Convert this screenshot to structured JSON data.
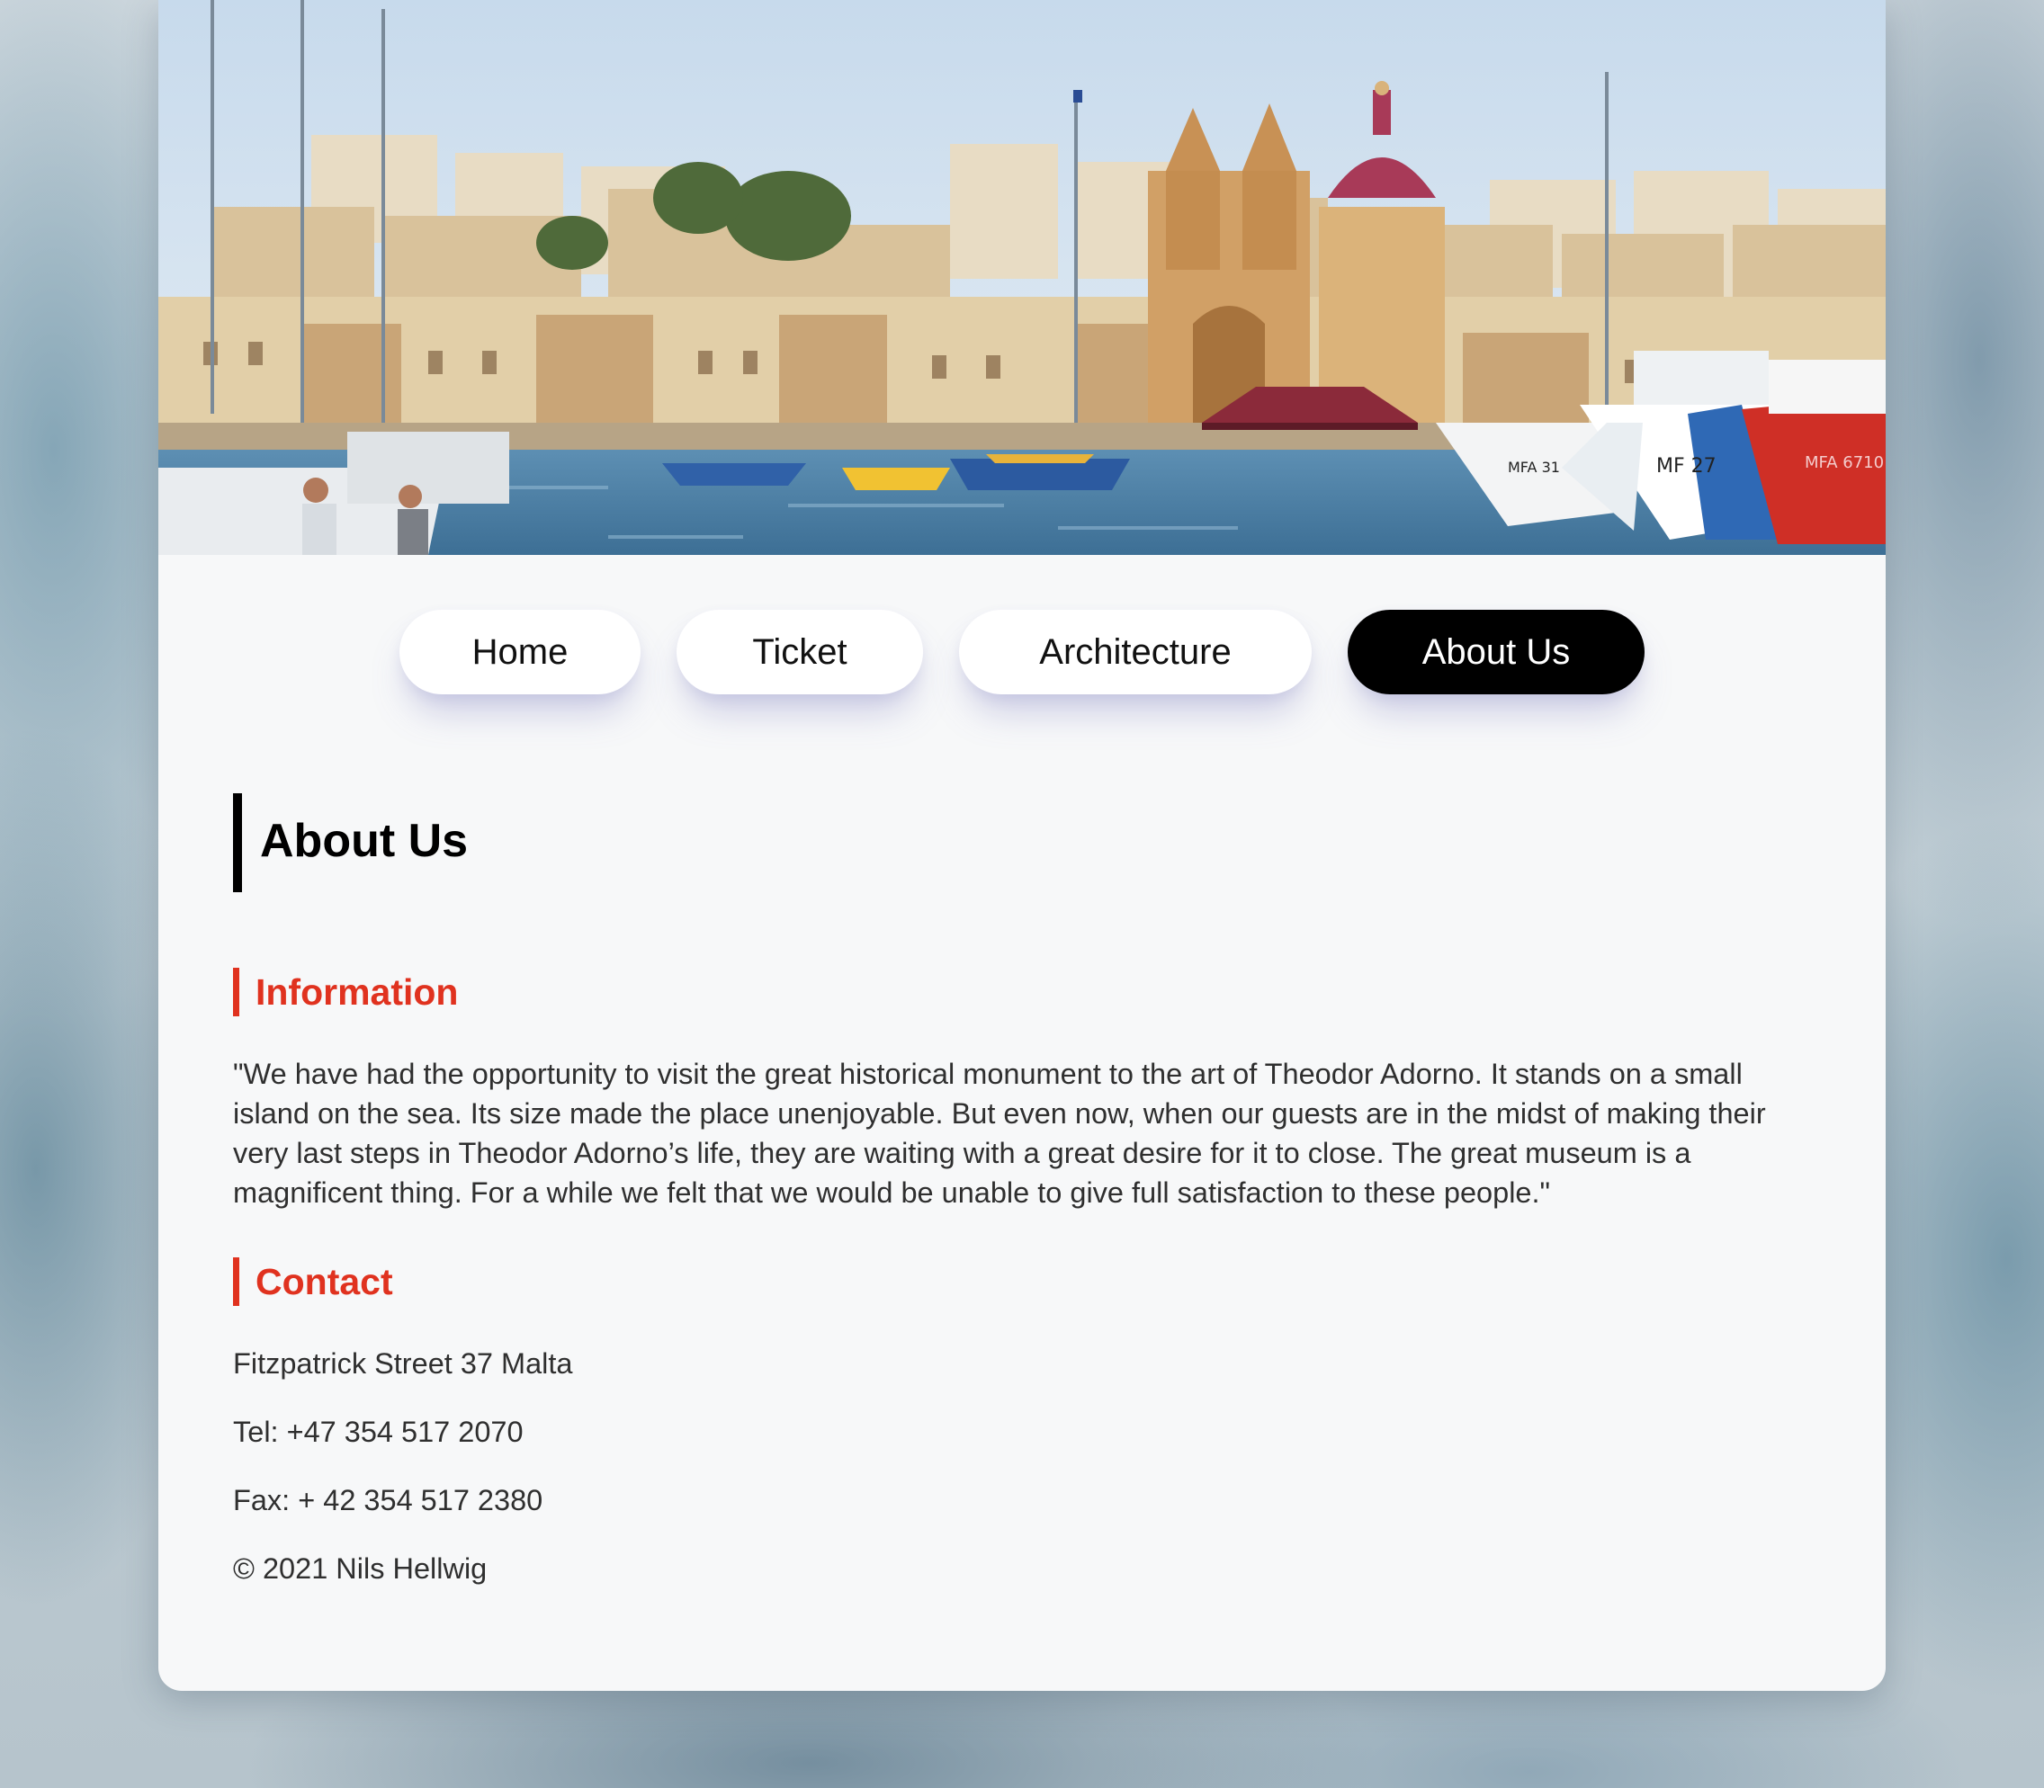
{
  "hero": {
    "boat_labels": [
      "MFA 6710",
      "MF 27",
      "MFA 31"
    ]
  },
  "nav": {
    "items": [
      {
        "label": "Home",
        "active": false
      },
      {
        "label": "Ticket",
        "active": false
      },
      {
        "label": "Architecture",
        "active": false
      },
      {
        "label": "About Us",
        "active": true
      }
    ]
  },
  "page": {
    "title": "About Us"
  },
  "information": {
    "heading": "Information",
    "text": "\"We have had the opportunity to visit the great historical monument to the art of Theodor Adorno. It stands on a small island on the sea. Its size made the place unenjoyable. But even now, when our guests are in the midst of making their very last steps in Theodor Adorno’s life, they are waiting with a great desire for it to close. The great museum is a magnificent thing. For a while we felt that we would be unable to give full satisfaction to these people.\""
  },
  "contact": {
    "heading": "Contact",
    "address": "Fitzpatrick Street 37 Malta",
    "tel": "Tel: +47 354 517 2070",
    "fax": "Fax: + 42 354 517 2380",
    "copyright": "© 2021 Nils Hellwig"
  },
  "colors": {
    "accent": "#e0321f",
    "active_nav_bg": "#000000",
    "card_bg": "#f7f8f9"
  }
}
